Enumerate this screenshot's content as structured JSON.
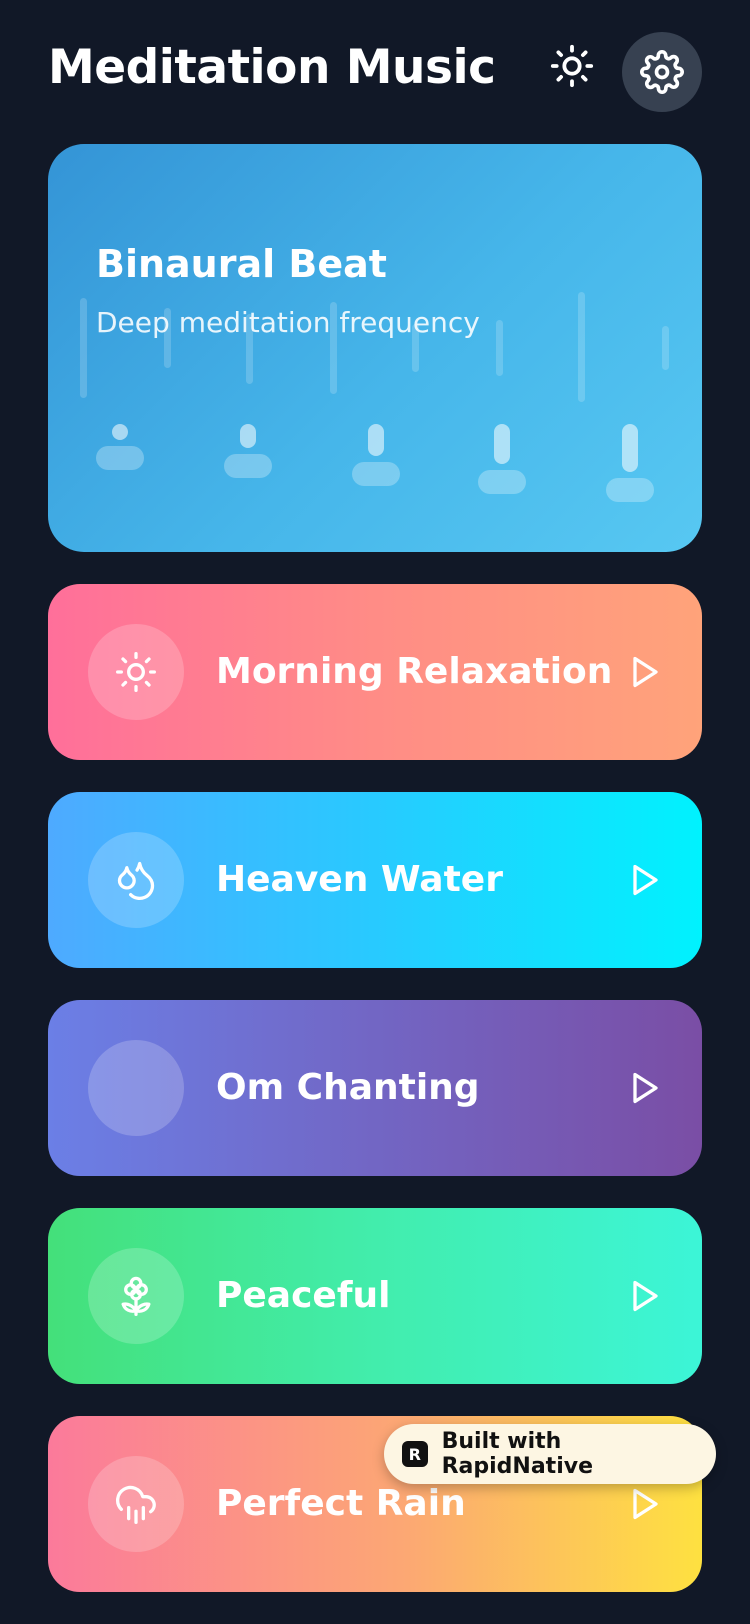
{
  "header": {
    "title": "Meditation Music",
    "sun_icon": "sun-icon",
    "settings_icon": "gear-icon"
  },
  "hero": {
    "title": "Binaural Beat",
    "subtitle": "Deep meditation frequency",
    "gradient": [
      "#3494d6",
      "#57c8f2"
    ]
  },
  "tracks": [
    {
      "label": "Morning Relaxation",
      "icon": "sun-icon",
      "colors": [
        "#ff6f9a",
        "#ffa37a"
      ]
    },
    {
      "label": "Heaven Water",
      "icon": "water-drops-icon",
      "colors": [
        "#4eaaff",
        "#00f2fe"
      ]
    },
    {
      "label": "Om Chanting",
      "icon": "om-icon",
      "colors": [
        "#6b7fe6",
        "#7a4ea5"
      ]
    },
    {
      "label": "Peaceful",
      "icon": "flower-icon",
      "colors": [
        "#44e07a",
        "#3cf5d7"
      ]
    },
    {
      "label": "Perfect Rain",
      "icon": "rain-cloud-icon",
      "colors": [
        "#fb7a9b",
        "#fee140"
      ]
    }
  ],
  "badge": {
    "text": "Built with RapidNative",
    "logo_letter": "R"
  },
  "colors": {
    "background": "#111827",
    "settings_button": "#374151"
  }
}
